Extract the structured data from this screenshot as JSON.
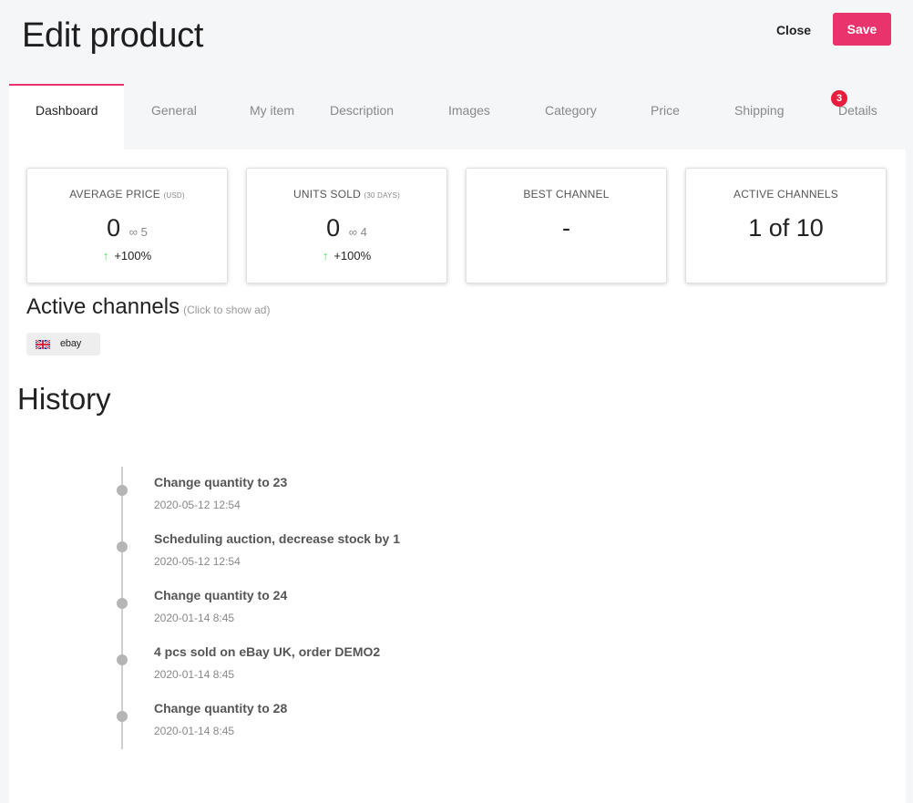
{
  "header": {
    "title": "Edit product",
    "close_label": "Close",
    "save_label": "Save",
    "accent_color": "#e8336d"
  },
  "tabs": [
    {
      "label": "Dashboard",
      "active": true
    },
    {
      "label": "General"
    },
    {
      "label": "My item"
    },
    {
      "label": "Description"
    },
    {
      "label": "Images"
    },
    {
      "label": "Category"
    },
    {
      "label": "Price"
    },
    {
      "label": "Shipping"
    },
    {
      "label": "Details",
      "badge": "3"
    }
  ],
  "cards": [
    {
      "label": "AVERAGE PRICE",
      "label_small": "(USD)",
      "value": "0",
      "sub": "∞ 5",
      "change": "+100%"
    },
    {
      "label": "UNITS SOLD",
      "label_small": "(30 DAYS)",
      "value": "0",
      "sub": "∞ 4",
      "change": "+100%"
    },
    {
      "label": "BEST CHANNEL",
      "value": "-"
    },
    {
      "label": "ACTIVE CHANNELS",
      "value": "1 of 10"
    }
  ],
  "active_channels": {
    "title": "Active channels",
    "hint": "(Click to show ad)",
    "chips": [
      {
        "label": "ebay",
        "flag": "uk-flag"
      }
    ]
  },
  "history": {
    "title": "History",
    "items": [
      {
        "title": "Change quantity to 23",
        "time": "2020-05-12 12:54"
      },
      {
        "title": "Scheduling auction, decrease stock by 1",
        "time": "2020-05-12 12:54"
      },
      {
        "title": "Change quantity to 24",
        "time": "2020-01-14 8:45"
      },
      {
        "title": "4 pcs sold on eBay UK, order DEMO2",
        "time": "2020-01-14 8:45"
      },
      {
        "title": "Change quantity to 28",
        "time": "2020-01-14 8:45"
      }
    ]
  }
}
